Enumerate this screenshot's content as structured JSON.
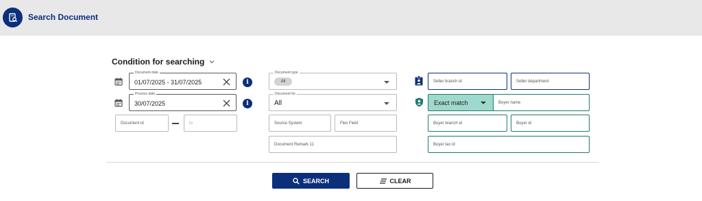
{
  "header": {
    "title": "Search Document",
    "icon": "document-search-icon"
  },
  "section": {
    "title": "Condition for searching",
    "toggle_icon": "chevron-down-icon"
  },
  "fields": {
    "document_date": {
      "label": "Document date",
      "value": "01/07/2025 - 31/07/2025"
    },
    "process_date": {
      "label": "Process date",
      "value": "30/07/2025"
    },
    "document_id": {
      "placeholder": "Document id"
    },
    "document_id_to": {
      "placeholder": "to"
    },
    "document_type": {
      "label": "Document type",
      "value": "All"
    },
    "document_for": {
      "label": "Document for",
      "value": "All"
    },
    "source_system": {
      "placeholder": "Source System"
    },
    "flex_field": {
      "placeholder": "Flex Field"
    },
    "document_remark": {
      "placeholder": "Document Remark 11"
    },
    "seller_branch_id": {
      "placeholder": "Seller branch id"
    },
    "seller_department": {
      "placeholder": "Seller department"
    },
    "match_mode": {
      "value": "Exact match"
    },
    "buyer_name": {
      "placeholder": "Buyer name"
    },
    "buyer_branch_id": {
      "placeholder": "Buyer branch id"
    },
    "buyer_id": {
      "placeholder": "Buyer id"
    },
    "buyer_tax_id": {
      "placeholder": "Buyer tax id"
    }
  },
  "buttons": {
    "search": "SEARCH",
    "clear": "CLEAR"
  },
  "colors": {
    "primary": "#0b2f7a",
    "teal": "#1e7a6e",
    "teal_fill": "#9fd8cd",
    "header_bg": "#e8e8e8"
  }
}
